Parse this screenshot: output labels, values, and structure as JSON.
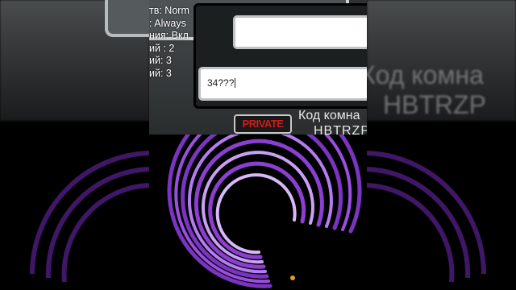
{
  "settings": {
    "lines": [
      "тв: Norm",
      ": Always",
      "ния: Вкл",
      "ий : 2",
      "ий: 3",
      "ий: 3"
    ]
  },
  "code_input": {
    "value": "34???"
  },
  "room": {
    "badge": "PRIVATE",
    "code_label": "Код комна",
    "code_value": "HBTRZP"
  },
  "right_side": {
    "line1": "Код комна",
    "line2": "HBTRZP"
  },
  "colors": {
    "spiral": "#8b3fd1",
    "spiral_light": "#b47cf0",
    "badge_text": "#d21a1a"
  }
}
